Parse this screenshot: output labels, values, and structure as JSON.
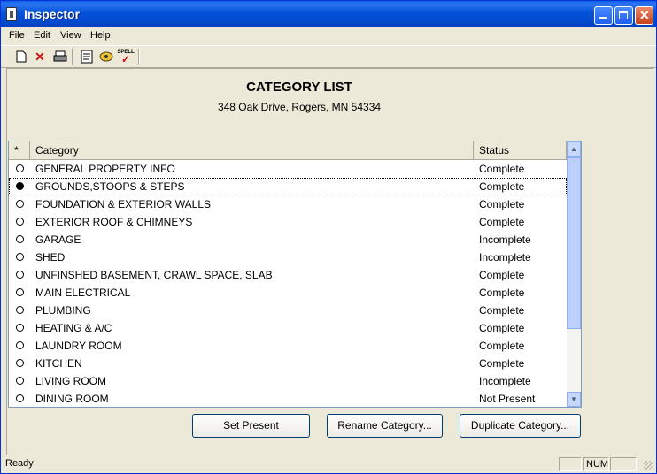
{
  "window": {
    "title": "Inspector"
  },
  "menu": [
    "File",
    "Edit",
    "View",
    "Help"
  ],
  "toolbar": {
    "spell_label": "SPELL"
  },
  "header": {
    "title": "CATEGORY LIST",
    "address": "348 Oak Drive, Rogers, MN 54334"
  },
  "list": {
    "columns": [
      "*",
      "Category",
      "Status"
    ],
    "rows": [
      {
        "category": "GENERAL PROPERTY INFO",
        "status": "Complete"
      },
      {
        "category": "GROUNDS,STOOPS & STEPS",
        "status": "Complete"
      },
      {
        "category": "FOUNDATION & EXTERIOR WALLS",
        "status": "Complete"
      },
      {
        "category": "EXTERIOR ROOF & CHIMNEYS",
        "status": "Complete"
      },
      {
        "category": "GARAGE",
        "status": "Incomplete"
      },
      {
        "category": "SHED",
        "status": "Incomplete"
      },
      {
        "category": "UNFINSHED BASEMENT, CRAWL SPACE, SLAB",
        "status": "Complete"
      },
      {
        "category": "MAIN ELECTRICAL",
        "status": "Complete"
      },
      {
        "category": "PLUMBING",
        "status": "Complete"
      },
      {
        "category": "HEATING & A/C",
        "status": "Complete"
      },
      {
        "category": "LAUNDRY ROOM",
        "status": "Complete"
      },
      {
        "category": "KITCHEN",
        "status": "Complete"
      },
      {
        "category": "LIVING ROOM",
        "status": "Incomplete"
      },
      {
        "category": "DINING ROOM",
        "status": "Not Present"
      }
    ]
  },
  "buttons": {
    "set_present": "Set Present",
    "rename": "Rename Category...",
    "duplicate": "Duplicate Category..."
  },
  "status": {
    "text": "Ready",
    "num": "NUM"
  },
  "colors": {
    "titlebar": "#0452d9",
    "face": "#ece9d8",
    "selected_radio": "#000000"
  },
  "icons": [
    "new-icon",
    "delete-icon",
    "print-icon",
    "report-icon",
    "photo-icon",
    "spellcheck-icon"
  ]
}
